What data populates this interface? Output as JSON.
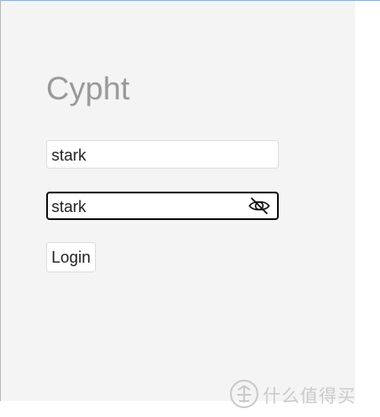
{
  "app": {
    "title": "Cypht"
  },
  "login_form": {
    "username_value": "stark",
    "password_value": "stark",
    "password_toggle_icon": "eye-slash-icon",
    "login_label": "Login"
  },
  "watermark": {
    "text": "什么值得买",
    "logo_icon": "value-logo-icon"
  },
  "colors": {
    "panel_background": "#f4f4f4",
    "title_gray": "#999999",
    "active_border": "#111111",
    "top_border_blue": "#8fb3d9"
  }
}
